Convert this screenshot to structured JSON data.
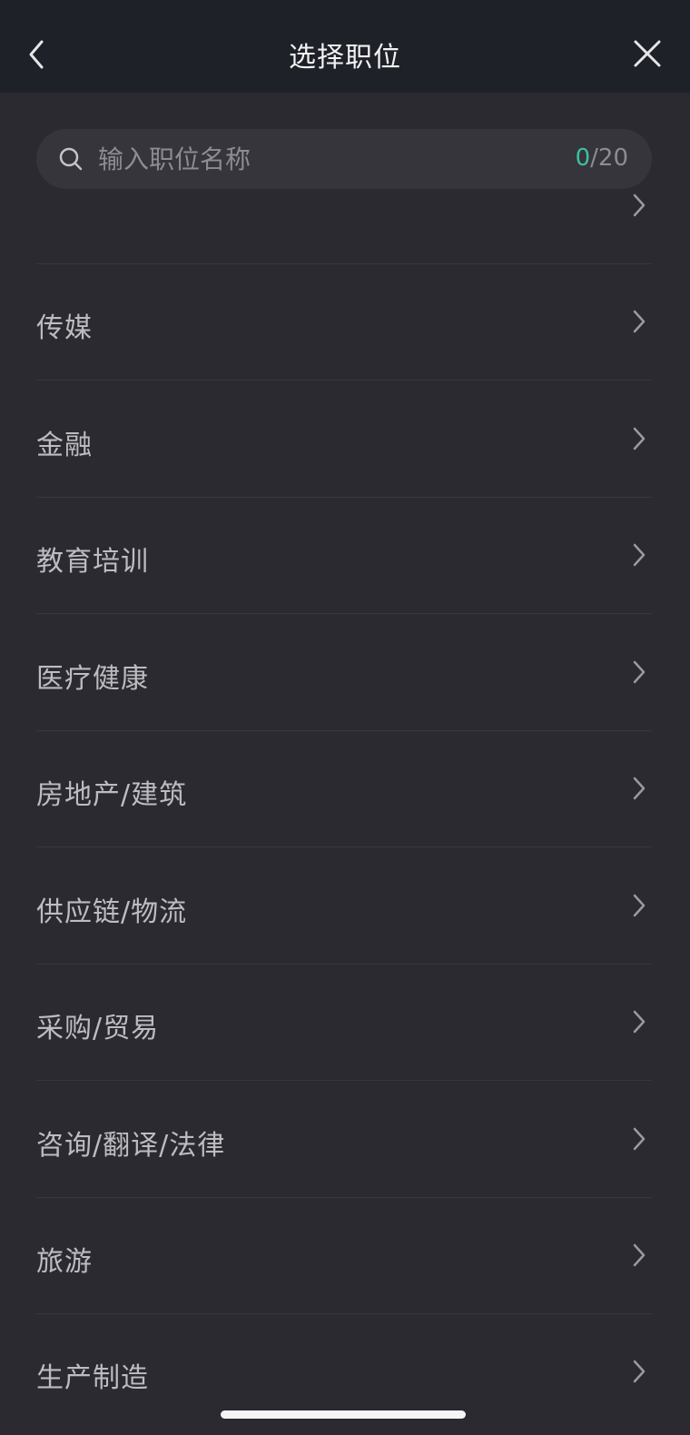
{
  "nav": {
    "title": "选择职位",
    "back_icon": "chevron-left-icon",
    "close_icon": "close-icon"
  },
  "search": {
    "placeholder": "输入职位名称",
    "counter_current": "0",
    "counter_max": "/20",
    "icon": "search-icon"
  },
  "categories": [
    {
      "label": "传媒"
    },
    {
      "label": "金融"
    },
    {
      "label": "教育培训"
    },
    {
      "label": "医疗健康"
    },
    {
      "label": "房地产/建筑"
    },
    {
      "label": "供应链/物流"
    },
    {
      "label": "采购/贸易"
    },
    {
      "label": "咨询/翻译/法律"
    },
    {
      "label": "旅游"
    },
    {
      "label": "生产制造"
    }
  ],
  "colors": {
    "background": "#2b2a30",
    "nav_background": "#1e2128",
    "accent": "#3fbf9f"
  }
}
